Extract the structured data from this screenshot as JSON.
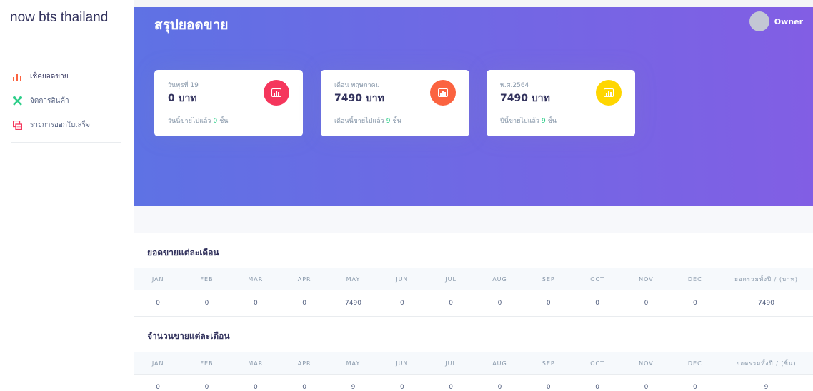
{
  "brand": "now bts thailand",
  "sidebar": {
    "items": [
      {
        "label": "เช็คยอดขาย",
        "icon": "bar-chart-icon",
        "color": "#fb6340"
      },
      {
        "label": "จัดการสินค้า",
        "icon": "tools-icon",
        "color": "#2dce89"
      },
      {
        "label": "รายการออกใบเสร็จ",
        "icon": "receipt-icon",
        "color": "#f5365c"
      }
    ]
  },
  "header": {
    "title": "สรุปยอดขาย",
    "user_name": "Owner"
  },
  "cards": [
    {
      "subtitle": "วันพุธที่ 19",
      "value": "0 บาท",
      "footer_prefix": "วันนี้ขายไปแล้ว",
      "footer_count": "0",
      "footer_suffix": "ชิ้น",
      "icon": "bar-chart-icon",
      "icon_color": "#f5365c"
    },
    {
      "subtitle": "เดือน พฤษภาคม",
      "value": "7490 บาท",
      "footer_prefix": "เดือนนี้ขายไปแล้ว",
      "footer_count": "9",
      "footer_suffix": "ชิ้น",
      "icon": "bar-chart-icon",
      "icon_color": "#fb6340"
    },
    {
      "subtitle": "พ.ศ.2564",
      "value": "7490 บาท",
      "footer_prefix": "ปีนี้ขายไปแล้ว",
      "footer_count": "9",
      "footer_suffix": "ชิ้น",
      "icon": "bar-chart-icon",
      "icon_color": "#ffd600"
    }
  ],
  "sales_table": {
    "title": "ยอดขายแต่ละเดือน",
    "headers": [
      "JAN",
      "FEB",
      "MAR",
      "APR",
      "MAY",
      "JUN",
      "JUL",
      "AUG",
      "SEP",
      "OCT",
      "NOV",
      "DEC",
      "ยอดรวมทั้งปี / (บาท)"
    ],
    "values": [
      "0",
      "0",
      "0",
      "0",
      "7490",
      "0",
      "0",
      "0",
      "0",
      "0",
      "0",
      "0",
      "7490"
    ]
  },
  "count_table": {
    "title": "จำนวนขายแต่ละเดือน",
    "headers": [
      "JAN",
      "FEB",
      "MAR",
      "APR",
      "MAY",
      "JUN",
      "JUL",
      "AUG",
      "SEP",
      "OCT",
      "NOV",
      "DEC",
      "ยอดรวมทั้งปี / (ชิ้น)"
    ],
    "values": [
      "0",
      "0",
      "0",
      "0",
      "9",
      "0",
      "0",
      "0",
      "0",
      "0",
      "0",
      "0",
      "9"
    ]
  }
}
